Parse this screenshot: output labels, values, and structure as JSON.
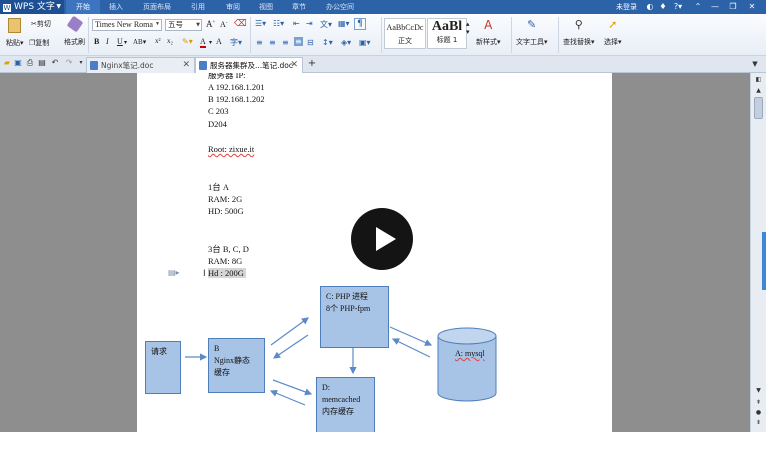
{
  "app": {
    "title": "WPS 文字",
    "login": "未登录"
  },
  "menu": {
    "tabs": [
      "开始",
      "插入",
      "页面布局",
      "引用",
      "审阅",
      "视图",
      "章节",
      "办公空间"
    ],
    "active": 0
  },
  "ribbon": {
    "paste": "粘贴",
    "cut": "剪切",
    "copy": "复制",
    "format_painter": "格式刷",
    "font_name": "Times New Roma",
    "font_size": "五号",
    "style_normal_preview": "AaBbCcDc",
    "style_normal": "正文",
    "style_h1_preview": "AaBl",
    "style_h1": "标题 1",
    "new_style": "新样式",
    "text_tools": "文字工具",
    "find_replace": "查找替换",
    "select": "选择"
  },
  "doc_tabs": [
    {
      "label": "Nginx笔记.doc",
      "active": false
    },
    {
      "label": "服务器集群及...笔记.doc",
      "active": true
    }
  ],
  "doc": {
    "lines": [
      "服务器 IP:",
      "A 192.168.1.201",
      "B 192.168.1.202",
      "C 203",
      "D204",
      "Root: zixue.it",
      "1台 A",
      "RAM: 2G",
      "HD: 500G",
      "3台 B, C, D",
      "RAM: 8G",
      "Hd : 200G"
    ],
    "diagram": {
      "request": "请求",
      "b_box": [
        "B",
        "Nginx静态",
        "缓存"
      ],
      "c_box": [
        "C: PHP 进程",
        "8个 PHP-fpm"
      ],
      "d_box": [
        "D:",
        "memcached",
        "内存缓存"
      ],
      "a_db": "A: mysql"
    }
  },
  "colors": {
    "titlebar": "#2b62a8",
    "accent": "#3c74bf",
    "box_fill": "#a7c3e6",
    "box_border": "#4f7fba"
  },
  "overlay": {
    "icon": "play-icon"
  }
}
